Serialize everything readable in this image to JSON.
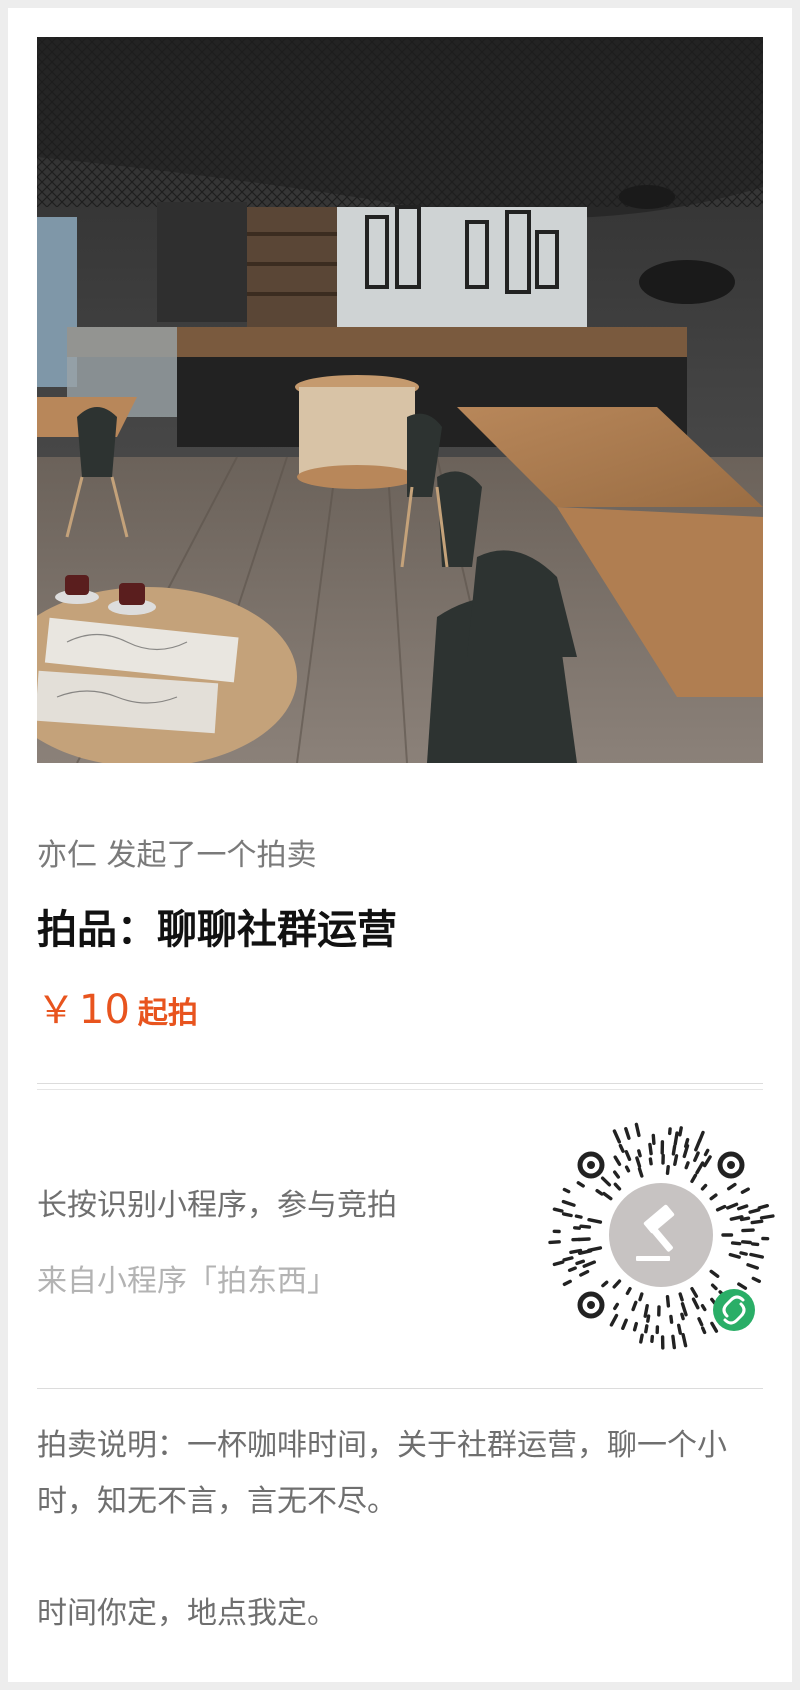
{
  "post": {
    "initiator_line": "亦仁 发起了一个拍卖",
    "item_title": "拍品：聊聊社群运营",
    "price": {
      "currency": "￥",
      "amount": "10",
      "suffix": "起拍",
      "color": "#e8541e"
    }
  },
  "mini_program": {
    "hint": "长按识别小程序，参与竞拍",
    "source": "来自小程序「拍东西」",
    "qr_logo_icon": "gavel-icon",
    "badge_icon": "link-icon",
    "badge_color": "#2aae67"
  },
  "description": {
    "line1": "拍卖说明：一杯咖啡时间，关于社群运营，聊一个小时，知无不言，言无不尽。",
    "line2": "时间你定，地点我定。"
  }
}
